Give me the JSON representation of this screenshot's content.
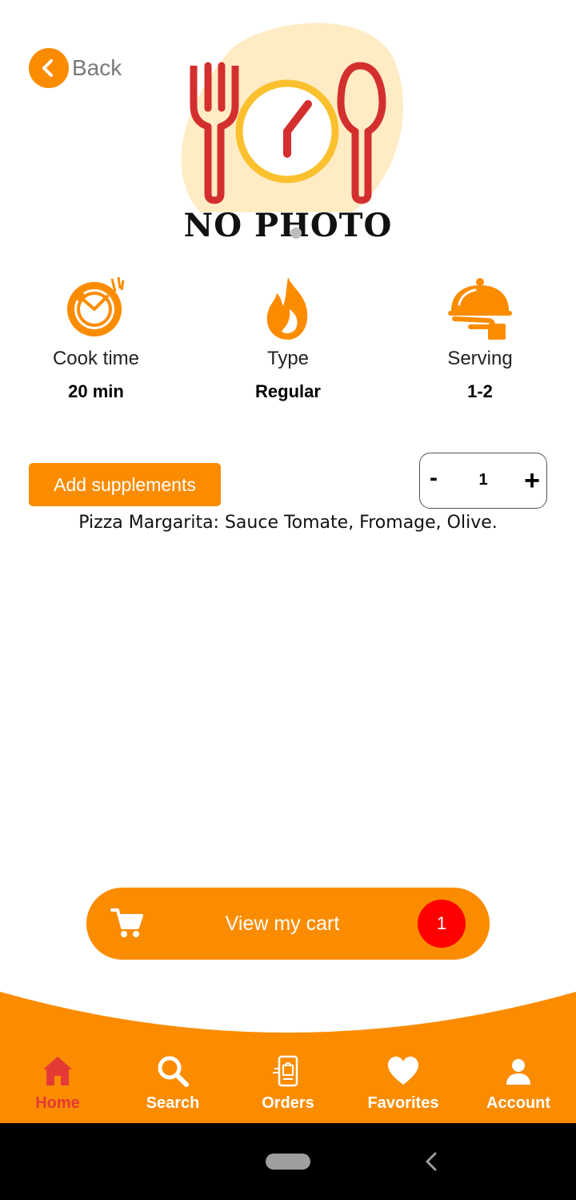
{
  "hero": {
    "placeholder_text": "NO PHOTO",
    "carousel_pages": 2,
    "active_page": 1
  },
  "back": {
    "label": "Back"
  },
  "info": [
    {
      "icon": "cook-time-icon",
      "label": "Cook time",
      "value": "20 min"
    },
    {
      "icon": "flame-icon",
      "label": "Type",
      "value": "Regular"
    },
    {
      "icon": "serving-cloche-icon",
      "label": "Serving",
      "value": "1-2"
    }
  ],
  "supplements": {
    "label": "Add supplements"
  },
  "quantity": {
    "minus": "-",
    "value": "1",
    "plus": "+"
  },
  "description": "Pizza Margarita: Sauce Tomate, Fromage, Olive.",
  "cart": {
    "label": "View my cart",
    "count": "1"
  },
  "nav": {
    "active": "Home",
    "items": [
      {
        "label": "Home",
        "icon": "home-icon"
      },
      {
        "label": "Search",
        "icon": "search-icon"
      },
      {
        "label": "Orders",
        "icon": "orders-icon"
      },
      {
        "label": "Favorites",
        "icon": "heart-icon"
      },
      {
        "label": "Account",
        "icon": "user-icon"
      }
    ]
  },
  "colors": {
    "accent": "#fb8c00",
    "active_nav": "#e53935",
    "badge": "#ff0000",
    "placeholder_red": "#d32f2f",
    "placeholder_yellow": "#fbc02d"
  }
}
